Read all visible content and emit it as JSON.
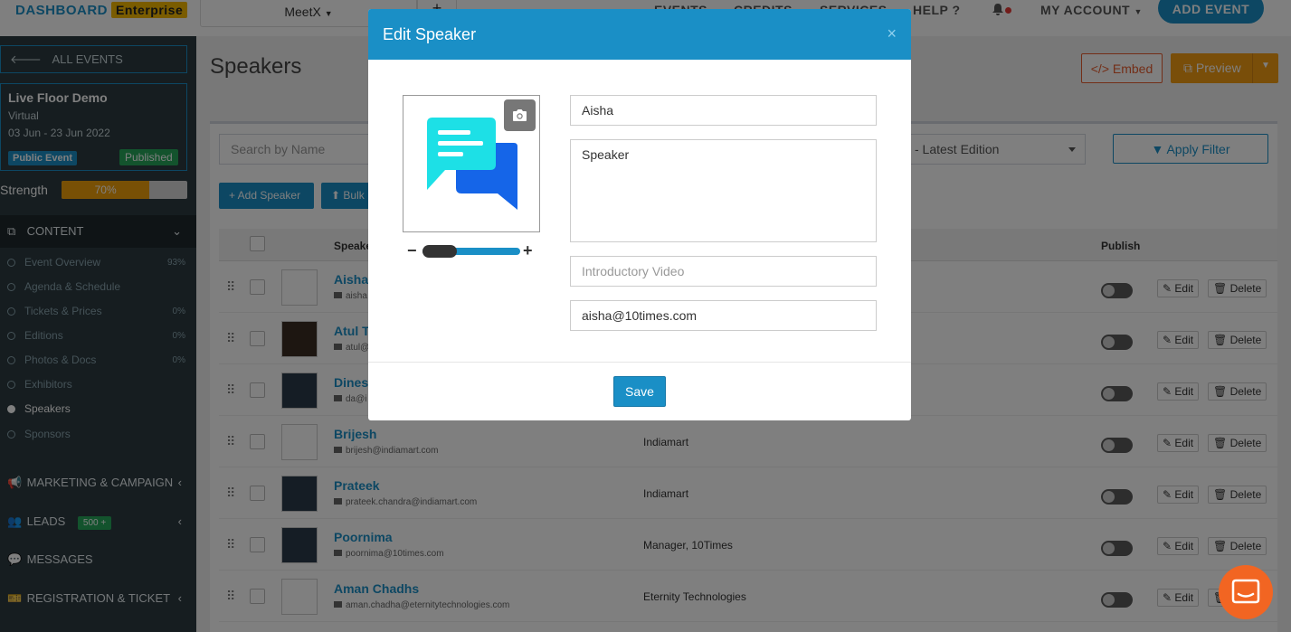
{
  "topbar": {
    "brand": "DASHBOARD",
    "brand_badge": "Enterprise",
    "event_picker": "MeetX",
    "nav": [
      "EVENTS",
      "CREDITS",
      "SERVICES",
      "HELP",
      "MY ACCOUNT"
    ],
    "add_event": "ADD EVENT"
  },
  "sidebar": {
    "all_events": "ALL EVENTS",
    "event": {
      "name": "Live Floor Demo",
      "type": "Virtual",
      "dates": "03 Jun - 23 Jun 2022",
      "badge_public": "Public Event",
      "badge_status": "Published"
    },
    "strength_label": "Strength",
    "strength_value": 70,
    "strength_text": "70%",
    "content_label": "CONTENT",
    "content_items": [
      {
        "label": "Event Overview",
        "pct": "93%"
      },
      {
        "label": "Agenda & Schedule",
        "pct": ""
      },
      {
        "label": "Tickets & Prices",
        "pct": "0%"
      },
      {
        "label": "Editions",
        "pct": "0%"
      },
      {
        "label": "Photos & Docs",
        "pct": "0%"
      },
      {
        "label": "Exhibitors",
        "pct": ""
      },
      {
        "label": "Speakers",
        "pct": ""
      },
      {
        "label": "Sponsors",
        "pct": ""
      }
    ],
    "marketing": "MARKETING & CAMPAIGN",
    "leads": "LEADS",
    "leads_badge": "500 +",
    "messages": "MESSAGES",
    "registration": "REGISTRATION & TICKET"
  },
  "main": {
    "title": "Speakers",
    "embed": "Embed",
    "preview": "Preview",
    "search_placeholder": "Search by Name",
    "edition": "- Latest Edition",
    "apply_filter": "Apply Filter",
    "add_speaker": "+ Add Speaker",
    "bulk": "Bulk",
    "col_speaker": "Speake",
    "col_publish": "Publish",
    "edit": "Edit",
    "delete": "Delete",
    "rows": [
      {
        "name": "Aisha",
        "email": "aisha",
        "company": ""
      },
      {
        "name": "Atul T",
        "email": "atul@",
        "company": ""
      },
      {
        "name": "Dines",
        "email": "da@i",
        "company": ""
      },
      {
        "name": "Brijesh",
        "email": "brijesh@indiamart.com",
        "company": "Indiamart"
      },
      {
        "name": "Prateek",
        "email": "prateek.chandra@indiamart.com",
        "company": "Indiamart"
      },
      {
        "name": "Poornima",
        "email": "poornima@10times.com",
        "company": "Manager, 10Times"
      },
      {
        "name": "Aman Chadhs",
        "email": "aman.chadha@eternitytechnologies.com",
        "company": "Eternity Technologies"
      }
    ]
  },
  "modal": {
    "title": "Edit Speaker",
    "close": "×",
    "name_value": "Aisha",
    "designation_value": "Speaker",
    "video_placeholder": "Introductory Video",
    "email_value": "aisha@10times.com",
    "zoom_level": 0.35,
    "save": "Save"
  },
  "colors": {
    "accent": "#1a8fc6",
    "sidebar": "#2c3b41",
    "warning": "#f39c12",
    "success": "#26a65b",
    "chat": "#f26522"
  }
}
